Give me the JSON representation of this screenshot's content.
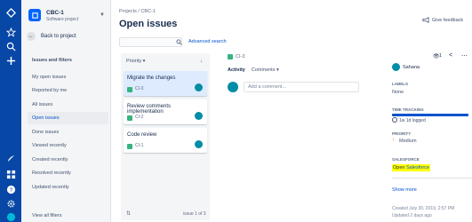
{
  "project": {
    "name": "CBC-1",
    "type": "Software project"
  },
  "nav": {
    "back_label": "Back to project"
  },
  "filters": {
    "title": "Issues and filters",
    "items": [
      "My open issues",
      "Reported by me",
      "All issues",
      "Open issues",
      "Done issues",
      "Viewed recently",
      "Created recently",
      "Resolved recently",
      "Updated recently"
    ],
    "view_all": "View all filters"
  },
  "main": {
    "breadcrumb": "Projects  /  CBC-1",
    "title": "Open issues",
    "feedback": "Give feedback",
    "advanced_search": "Advanced search"
  },
  "list": {
    "sort_label": "Priority",
    "sort_dir": "↓",
    "cards": [
      {
        "title": "Migrate the changes",
        "key": "CI-3"
      },
      {
        "title": "Review comments implementation",
        "key": "CI-2"
      },
      {
        "title": "Code review",
        "key": "CI-1"
      }
    ],
    "pager": "issue 1 of 3"
  },
  "detail": {
    "key": "CI-3",
    "activity": "Activity",
    "comments": "Comments",
    "comment_placeholder": "Add a comment..."
  },
  "rpanel": {
    "watch_count": "1",
    "assignee": "Sahana",
    "labels_title": "Labels",
    "labels_value": "None",
    "tt_title": "Time tracking",
    "tt_logged": "1w 1d logged",
    "priority_title": "Priority",
    "priority_value": "Medium",
    "sf_title": "Salesforce",
    "sf_prefix": "Open ",
    "sf_link": "Salesforce",
    "show_more": "Show more",
    "created": "Created July 30, 2019, 2:57 PM",
    "updated": "Updated 2 days ago"
  },
  "colors": {
    "accent": "#0052cc",
    "nav_bg": "#0747a6",
    "highlight": "#ffff00"
  },
  "icons": [
    "jira-logo-icon",
    "star-icon",
    "search-icon",
    "plus-icon",
    "rocket-icon",
    "grid-icon",
    "help-icon",
    "settings-icon",
    "profile-icon",
    "eye-icon",
    "share-icon",
    "more-icon",
    "clock-icon",
    "priority-arrow-icon"
  ]
}
